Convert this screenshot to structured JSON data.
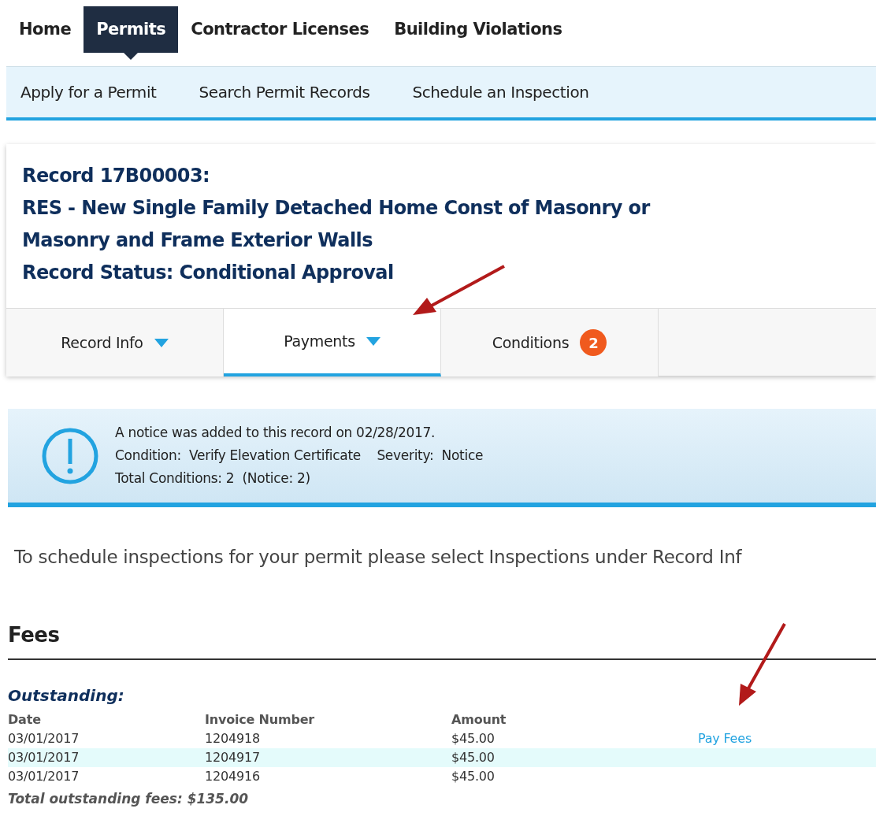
{
  "main_nav": [
    {
      "label": "Home",
      "selected": false
    },
    {
      "label": "Permits",
      "selected": true
    },
    {
      "label": "Contractor Licenses",
      "selected": false
    },
    {
      "label": "Building Violations",
      "selected": false
    }
  ],
  "sub_nav": [
    "Apply for a Permit",
    "Search Permit Records",
    "Schedule an Inspection"
  ],
  "record": {
    "title_lines": [
      "Record 17B00003:",
      "RES - New Single Family Detached Home Const of Masonry or",
      "Masonry and Frame Exterior Walls",
      "Record Status: Conditional Approval"
    ]
  },
  "record_tabs": [
    {
      "label": "Record Info",
      "selected": false,
      "dropdown": true
    },
    {
      "label": "Payments",
      "selected": true,
      "dropdown": true
    },
    {
      "label": "Conditions",
      "selected": false,
      "dropdown": false,
      "badge": "2"
    }
  ],
  "notice": {
    "lines": [
      "A notice was added to this record on 02/28/2017.",
      "Condition:  Verify Elevation Certificate    Severity:  Notice",
      "Total Conditions: 2  (Notice: 2)"
    ]
  },
  "instruction": "To schedule inspections for your permit please select Inspections under Record Inf",
  "fees": {
    "heading": "Fees",
    "section": "Outstanding:",
    "columns": [
      "Date",
      "Invoice Number",
      "Amount"
    ],
    "rows": [
      {
        "date": "03/01/2017",
        "invoice": "1204918",
        "amount": "$45.00",
        "action": "Pay Fees",
        "highlighted": false
      },
      {
        "date": "03/01/2017",
        "invoice": "1204917",
        "amount": "$45.00",
        "highlighted": true
      },
      {
        "date": "03/01/2017",
        "invoice": "1204916",
        "amount": "$45.00",
        "highlighted": false
      }
    ],
    "total": "Total outstanding fees: $135.00"
  }
}
